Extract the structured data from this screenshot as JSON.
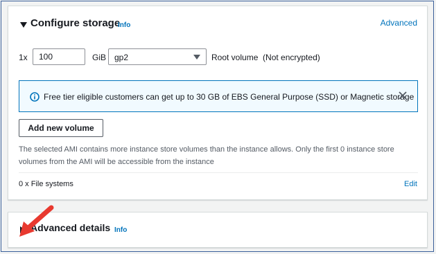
{
  "storage": {
    "title": "Configure storage",
    "info": "Info",
    "advanced_link": "Advanced",
    "volume": {
      "count_label": "1x",
      "size_value": "100",
      "unit": "GiB",
      "type_value": "gp2",
      "description": "Root volume  (Not encrypted)"
    },
    "alert": {
      "text": "Free tier eligible customers can get up to 30 GB of EBS General Purpose (SSD) or Magnetic storage"
    },
    "add_volume_button": "Add new volume",
    "note": "The selected AMI contains more instance store volumes than the instance allows. Only the first 0 instance store volumes from the AMI will be accessible from the instance",
    "file_systems": "0 x File systems",
    "edit_link": "Edit"
  },
  "advanced_details": {
    "title": "Advanced details",
    "info": "Info"
  },
  "colors": {
    "link": "#0073bb",
    "alert_bg": "#f1faff",
    "annotation_arrow": "#e8392f"
  }
}
